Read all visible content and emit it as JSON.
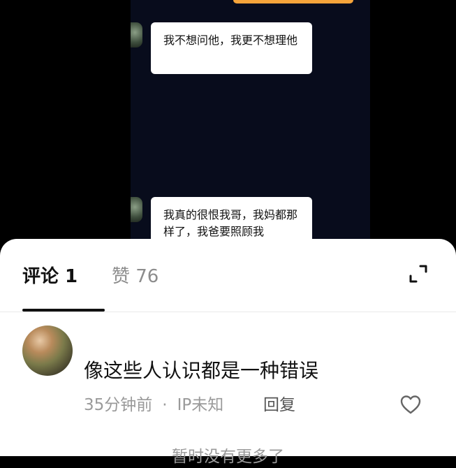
{
  "video": {
    "messages": [
      {
        "text": "我不想问他，我更不想理他"
      },
      {
        "text": "我真的很恨我哥，我妈都那样了，我爸要照顾我"
      }
    ]
  },
  "comments_panel": {
    "tabs": [
      {
        "label": "评论 1"
      },
      {
        "label": "赞 76"
      }
    ],
    "comments": [
      {
        "text": "像这些人认识都是一种错误",
        "time": "35分钟前",
        "separator": "·",
        "location": "IP未知",
        "reply_label": "回复"
      }
    ],
    "footer": "暂时没有更多了"
  },
  "colors": {
    "accent_bubble": "#f6a43a",
    "chat_bg": "#080c1c"
  },
  "icons": [
    "expand-icon",
    "heart-icon"
  ]
}
